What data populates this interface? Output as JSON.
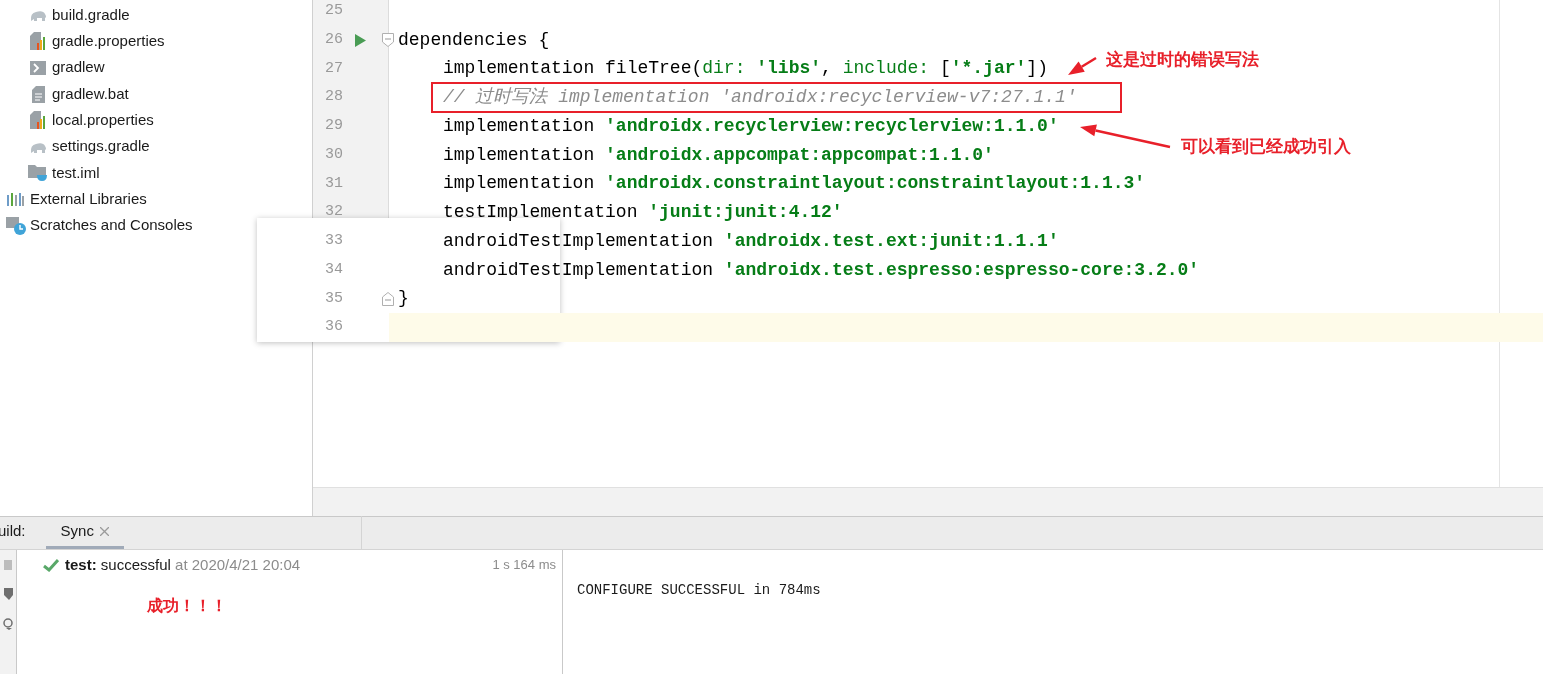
{
  "project_tree": {
    "inner_items": [
      {
        "label": "build.gradle",
        "kind": "gradle"
      },
      {
        "label": "gradle.properties",
        "kind": "properties"
      },
      {
        "label": "gradlew",
        "kind": "shell"
      },
      {
        "label": "gradlew.bat",
        "kind": "text"
      },
      {
        "label": "local.properties",
        "kind": "properties"
      },
      {
        "label": "settings.gradle",
        "kind": "gradle"
      },
      {
        "label": "test.iml",
        "kind": "module"
      }
    ],
    "root_items": [
      {
        "label": "External Libraries",
        "kind": "libraries"
      },
      {
        "label": "Scratches and Consoles",
        "kind": "scratches"
      }
    ]
  },
  "editor": {
    "lines": [
      {
        "number": "25"
      },
      {
        "number": "26",
        "run_marker": true,
        "fold_start": true,
        "segments": [
          {
            "kind": "plain",
            "text": "dependencies {"
          }
        ]
      },
      {
        "number": "27",
        "indented": true,
        "segments": [
          {
            "kind": "plain",
            "text": "implementation fileTree("
          },
          {
            "kind": "param",
            "text": "dir: "
          },
          {
            "kind": "string",
            "text": "'libs'"
          },
          {
            "kind": "plain",
            "text": ", "
          },
          {
            "kind": "param",
            "text": "include: "
          },
          {
            "kind": "plain",
            "text": "["
          },
          {
            "kind": "string",
            "text": "'*.jar'"
          },
          {
            "kind": "plain",
            "text": "])"
          }
        ]
      },
      {
        "number": "28",
        "indented": true,
        "boxed": true,
        "segments": [
          {
            "kind": "comment",
            "text": "// 过时写法 implementation 'androidx:recyclerview-v7:27.1.1'"
          }
        ]
      },
      {
        "number": "29",
        "indented": true,
        "segments": [
          {
            "kind": "plain",
            "text": "implementation "
          },
          {
            "kind": "string",
            "text": "'androidx.recyclerview:recyclerview:1.1.0'"
          }
        ]
      },
      {
        "number": "30",
        "indented": true,
        "segments": [
          {
            "kind": "plain",
            "text": "implementation "
          },
          {
            "kind": "string",
            "text": "'androidx.appcompat:appcompat:1.1.0'"
          }
        ]
      },
      {
        "number": "31",
        "indented": true,
        "segments": [
          {
            "kind": "plain",
            "text": "implementation "
          },
          {
            "kind": "string",
            "text": "'androidx.constraintlayout:constraintlayout:1.1.3'"
          }
        ]
      },
      {
        "number": "32",
        "indented": true,
        "segments": [
          {
            "kind": "plain",
            "text": "testImplementation "
          },
          {
            "kind": "string",
            "text": "'junit:junit:4.12'"
          }
        ]
      },
      {
        "number": "33",
        "indented": true,
        "segments": [
          {
            "kind": "plain",
            "text": "androidTestImplementation "
          },
          {
            "kind": "string",
            "text": "'androidx.test.ext:junit:1.1.1'"
          }
        ]
      },
      {
        "number": "34",
        "indented": true,
        "segments": [
          {
            "kind": "plain",
            "text": "androidTestImplementation "
          },
          {
            "kind": "string",
            "text": "'androidx.test.espresso:espresso-core:3.2.0'"
          }
        ]
      },
      {
        "number": "35",
        "fold_end": true,
        "segments": [
          {
            "kind": "plain",
            "text": "}"
          }
        ]
      },
      {
        "number": "36",
        "current": true
      }
    ]
  },
  "callouts": [
    {
      "text": "这是过时的错误写法"
    },
    {
      "text": "可以看到已经成功引入"
    }
  ],
  "build_panel": {
    "label": "uild:",
    "tabs": [
      {
        "label": "Sync",
        "selected": true,
        "closable": true
      }
    ],
    "result": {
      "ok": true,
      "name": "test:",
      "status": "successful",
      "time": "at 2020/4/21 20:04",
      "duration": "1 s 164 ms"
    },
    "note": "成功！！！",
    "console": [
      "CONFIGURE SUCCESSFUL in 784ms"
    ]
  }
}
